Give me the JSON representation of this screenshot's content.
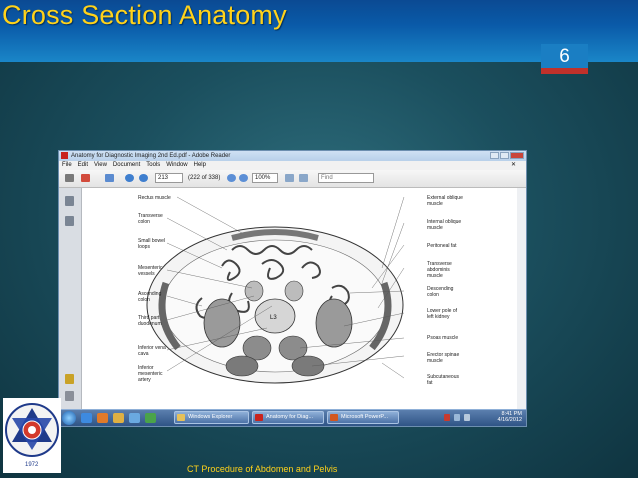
{
  "slide": {
    "title": "Cross Section Anatomy",
    "number": "6",
    "footer": "CT Procedure of Abdomen and Pelvis"
  },
  "logo": {
    "text": "INSTITUTE OF MEDICINE",
    "year": "1972"
  },
  "window": {
    "title": "Anatomy for Diagnostic Imaging 2nd Ed.pdf - Adobe Reader",
    "menu": [
      "File",
      "Edit",
      "View",
      "Document",
      "Tools",
      "Window",
      "Help"
    ],
    "page_value": "213",
    "page_count": "(222 of 338)",
    "zoom": "100%",
    "find_placeholder": "Find"
  },
  "diagram": {
    "center_label": "L3",
    "left_labels": [
      "Rectus muscle",
      "Transverse colon",
      "Small bowel loops",
      "Mesenteric vessels",
      "Ascending colon",
      "Third part duodenum",
      "Inferior vena cava",
      "Inferior mesenteric artery"
    ],
    "right_labels": [
      "External oblique muscle",
      "Internal oblique muscle",
      "Peritoneal fat",
      "Transverse abdominis muscle",
      "Descending colon",
      "Lower pole of left kidney",
      "Psoas muscle",
      "Erector spinae muscle",
      "Subcutaneous fat"
    ]
  },
  "taskbar": {
    "buttons": [
      "Windows Explorer",
      "Anatomy for Diag...",
      "Microsoft PowerP..."
    ],
    "time": "8:41 PM",
    "date": "4/16/2012"
  },
  "colors": {
    "title_text": "#ffd21a",
    "title_bar": "#0a5aa8",
    "slide_number_accent": "#c0312b",
    "background": "#1b4f5e"
  }
}
